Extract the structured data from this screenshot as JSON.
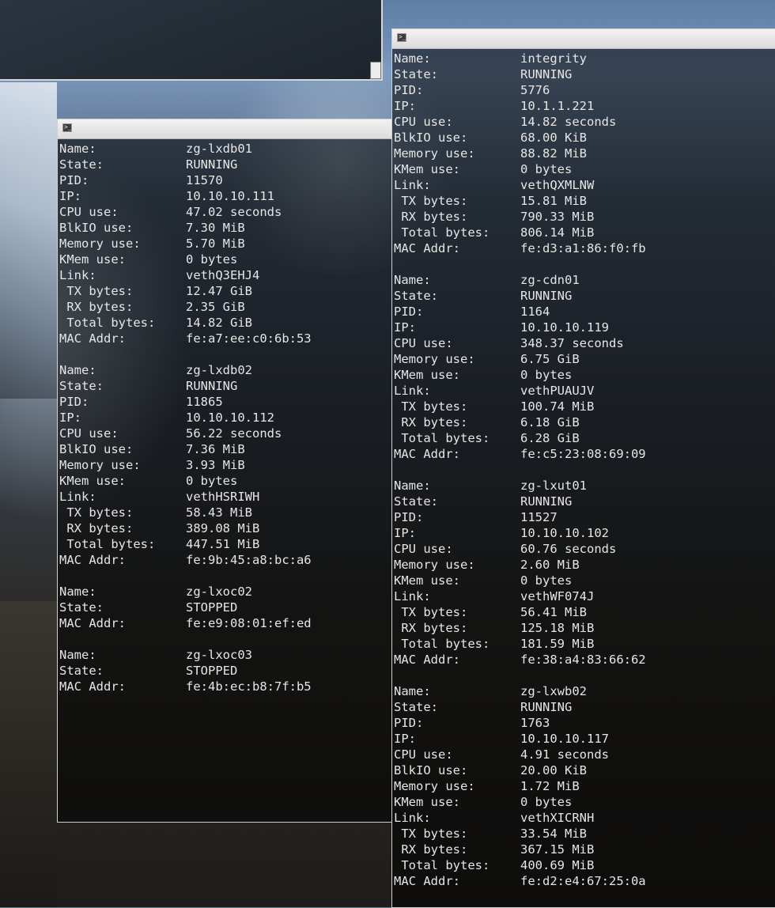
{
  "left_terminal": {
    "containers": [
      {
        "fields": [
          {
            "label": "Name:",
            "value": "zg-lxdb01"
          },
          {
            "label": "State:",
            "value": "RUNNING"
          },
          {
            "label": "PID:",
            "value": "11570"
          },
          {
            "label": "IP:",
            "value": "10.10.10.111"
          },
          {
            "label": "CPU use:",
            "value": "47.02 seconds"
          },
          {
            "label": "BlkIO use:",
            "value": "7.30 MiB"
          },
          {
            "label": "Memory use:",
            "value": "5.70 MiB"
          },
          {
            "label": "KMem use:",
            "value": "0 bytes"
          },
          {
            "label": "Link:",
            "value": "vethQ3EHJ4"
          },
          {
            "label": " TX bytes:",
            "value": "12.47 GiB"
          },
          {
            "label": " RX bytes:",
            "value": "2.35 GiB"
          },
          {
            "label": " Total bytes:",
            "value": "14.82 GiB"
          },
          {
            "label": "MAC Addr:",
            "value": "fe:a7:ee:c0:6b:53"
          }
        ]
      },
      {
        "fields": [
          {
            "label": "Name:",
            "value": "zg-lxdb02"
          },
          {
            "label": "State:",
            "value": "RUNNING"
          },
          {
            "label": "PID:",
            "value": "11865"
          },
          {
            "label": "IP:",
            "value": "10.10.10.112"
          },
          {
            "label": "CPU use:",
            "value": "56.22 seconds"
          },
          {
            "label": "BlkIO use:",
            "value": "7.36 MiB"
          },
          {
            "label": "Memory use:",
            "value": "3.93 MiB"
          },
          {
            "label": "KMem use:",
            "value": "0 bytes"
          },
          {
            "label": "Link:",
            "value": "vethHSRIWH"
          },
          {
            "label": " TX bytes:",
            "value": "58.43 MiB"
          },
          {
            "label": " RX bytes:",
            "value": "389.08 MiB"
          },
          {
            "label": " Total bytes:",
            "value": "447.51 MiB"
          },
          {
            "label": "MAC Addr:",
            "value": "fe:9b:45:a8:bc:a6"
          }
        ]
      },
      {
        "fields": [
          {
            "label": "Name:",
            "value": "zg-lxoc02"
          },
          {
            "label": "State:",
            "value": "STOPPED"
          },
          {
            "label": "MAC Addr:",
            "value": "fe:e9:08:01:ef:ed"
          }
        ]
      },
      {
        "fields": [
          {
            "label": "Name:",
            "value": "zg-lxoc03"
          },
          {
            "label": "State:",
            "value": "STOPPED"
          },
          {
            "label": "MAC Addr:",
            "value": "fe:4b:ec:b8:7f:b5"
          }
        ]
      }
    ]
  },
  "right_terminal": {
    "containers": [
      {
        "fields": [
          {
            "label": "Name:",
            "value": "integrity"
          },
          {
            "label": "State:",
            "value": "RUNNING"
          },
          {
            "label": "PID:",
            "value": "5776"
          },
          {
            "label": "IP:",
            "value": "10.1.1.221"
          },
          {
            "label": "CPU use:",
            "value": "14.82 seconds"
          },
          {
            "label": "BlkIO use:",
            "value": "68.00 KiB"
          },
          {
            "label": "Memory use:",
            "value": "88.82 MiB"
          },
          {
            "label": "KMem use:",
            "value": "0 bytes"
          },
          {
            "label": "Link:",
            "value": "vethQXMLNW"
          },
          {
            "label": " TX bytes:",
            "value": "15.81 MiB"
          },
          {
            "label": " RX bytes:",
            "value": "790.33 MiB"
          },
          {
            "label": " Total bytes:",
            "value": "806.14 MiB"
          },
          {
            "label": "MAC Addr:",
            "value": "fe:d3:a1:86:f0:fb"
          }
        ]
      },
      {
        "fields": [
          {
            "label": "Name:",
            "value": "zg-cdn01"
          },
          {
            "label": "State:",
            "value": "RUNNING"
          },
          {
            "label": "PID:",
            "value": "1164"
          },
          {
            "label": "IP:",
            "value": "10.10.10.119"
          },
          {
            "label": "CPU use:",
            "value": "348.37 seconds"
          },
          {
            "label": "Memory use:",
            "value": "6.75 GiB"
          },
          {
            "label": "KMem use:",
            "value": "0 bytes"
          },
          {
            "label": "Link:",
            "value": "vethPUAUJV"
          },
          {
            "label": " TX bytes:",
            "value": "100.74 MiB"
          },
          {
            "label": " RX bytes:",
            "value": "6.18 GiB"
          },
          {
            "label": " Total bytes:",
            "value": "6.28 GiB"
          },
          {
            "label": "MAC Addr:",
            "value": "fe:c5:23:08:69:09"
          }
        ]
      },
      {
        "fields": [
          {
            "label": "Name:",
            "value": "zg-lxut01"
          },
          {
            "label": "State:",
            "value": "RUNNING"
          },
          {
            "label": "PID:",
            "value": "11527"
          },
          {
            "label": "IP:",
            "value": "10.10.10.102"
          },
          {
            "label": "CPU use:",
            "value": "60.76 seconds"
          },
          {
            "label": "Memory use:",
            "value": "2.60 MiB"
          },
          {
            "label": "KMem use:",
            "value": "0 bytes"
          },
          {
            "label": "Link:",
            "value": "vethWF074J"
          },
          {
            "label": " TX bytes:",
            "value": "56.41 MiB"
          },
          {
            "label": " RX bytes:",
            "value": "125.18 MiB"
          },
          {
            "label": " Total bytes:",
            "value": "181.59 MiB"
          },
          {
            "label": "MAC Addr:",
            "value": "fe:38:a4:83:66:62"
          }
        ]
      },
      {
        "fields": [
          {
            "label": "Name:",
            "value": "zg-lxwb02"
          },
          {
            "label": "State:",
            "value": "RUNNING"
          },
          {
            "label": "PID:",
            "value": "1763"
          },
          {
            "label": "IP:",
            "value": "10.10.10.117"
          },
          {
            "label": "CPU use:",
            "value": "4.91 seconds"
          },
          {
            "label": "BlkIO use:",
            "value": "20.00 KiB"
          },
          {
            "label": "Memory use:",
            "value": "1.72 MiB"
          },
          {
            "label": "KMem use:",
            "value": "0 bytes"
          },
          {
            "label": "Link:",
            "value": "vethXICRNH"
          },
          {
            "label": " TX bytes:",
            "value": "33.54 MiB"
          },
          {
            "label": " RX bytes:",
            "value": "367.15 MiB"
          },
          {
            "label": " Total bytes:",
            "value": "400.69 MiB"
          },
          {
            "label": "MAC Addr:",
            "value": "fe:d2:e4:67:25:0a"
          }
        ]
      }
    ]
  },
  "icons": {
    "terminal_icon": "terminal-icon"
  }
}
